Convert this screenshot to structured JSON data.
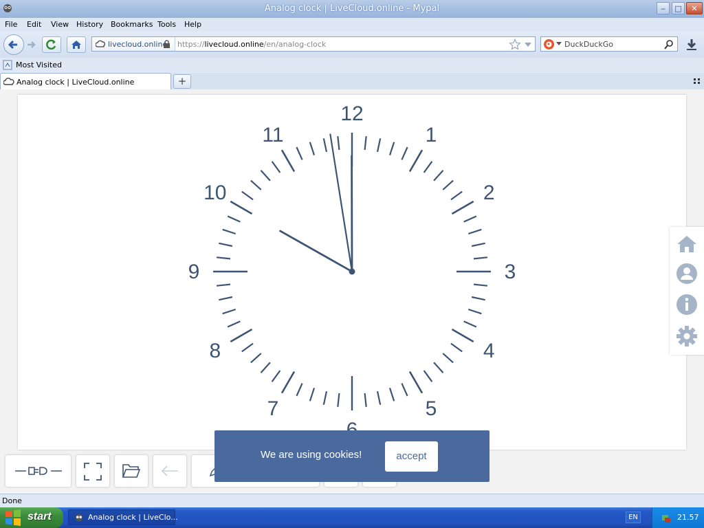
{
  "window": {
    "title": "Analog clock | LiveCloud.online - Mypal"
  },
  "menu": [
    "File",
    "Edit",
    "View",
    "History",
    "Bookmarks",
    "Tools",
    "Help"
  ],
  "nav": {
    "site_identity": "livecloud.online",
    "url_prefix": "https://",
    "url_host": "livecloud.online",
    "url_path": "/en/analog-clock",
    "search_engine": "DuckDuckGo"
  },
  "bookmarks": {
    "most_visited": "Most Visited"
  },
  "tabs": [
    {
      "label": "Analog clock | LiveCloud.online"
    }
  ],
  "clock": {
    "numbers": [
      "12",
      "1",
      "2",
      "3",
      "4",
      "5",
      "6",
      "7",
      "8",
      "9",
      "10",
      "11"
    ],
    "time": {
      "hours": 9,
      "minutes": 59,
      "seconds": 58.5
    },
    "hand_color": "#3d5473"
  },
  "side_panel": {
    "icons": [
      "home-icon",
      "user-icon",
      "info-icon",
      "gear-icon"
    ],
    "icon_color": "#a6b4c8"
  },
  "cookie": {
    "text": "We are using cookies!",
    "accept_label": "accept"
  },
  "status": {
    "text": "Done"
  },
  "taskbar": {
    "start_label": "start",
    "task_label": "Analog clock | LiveClo...",
    "language": "EN",
    "time": "21.57"
  }
}
